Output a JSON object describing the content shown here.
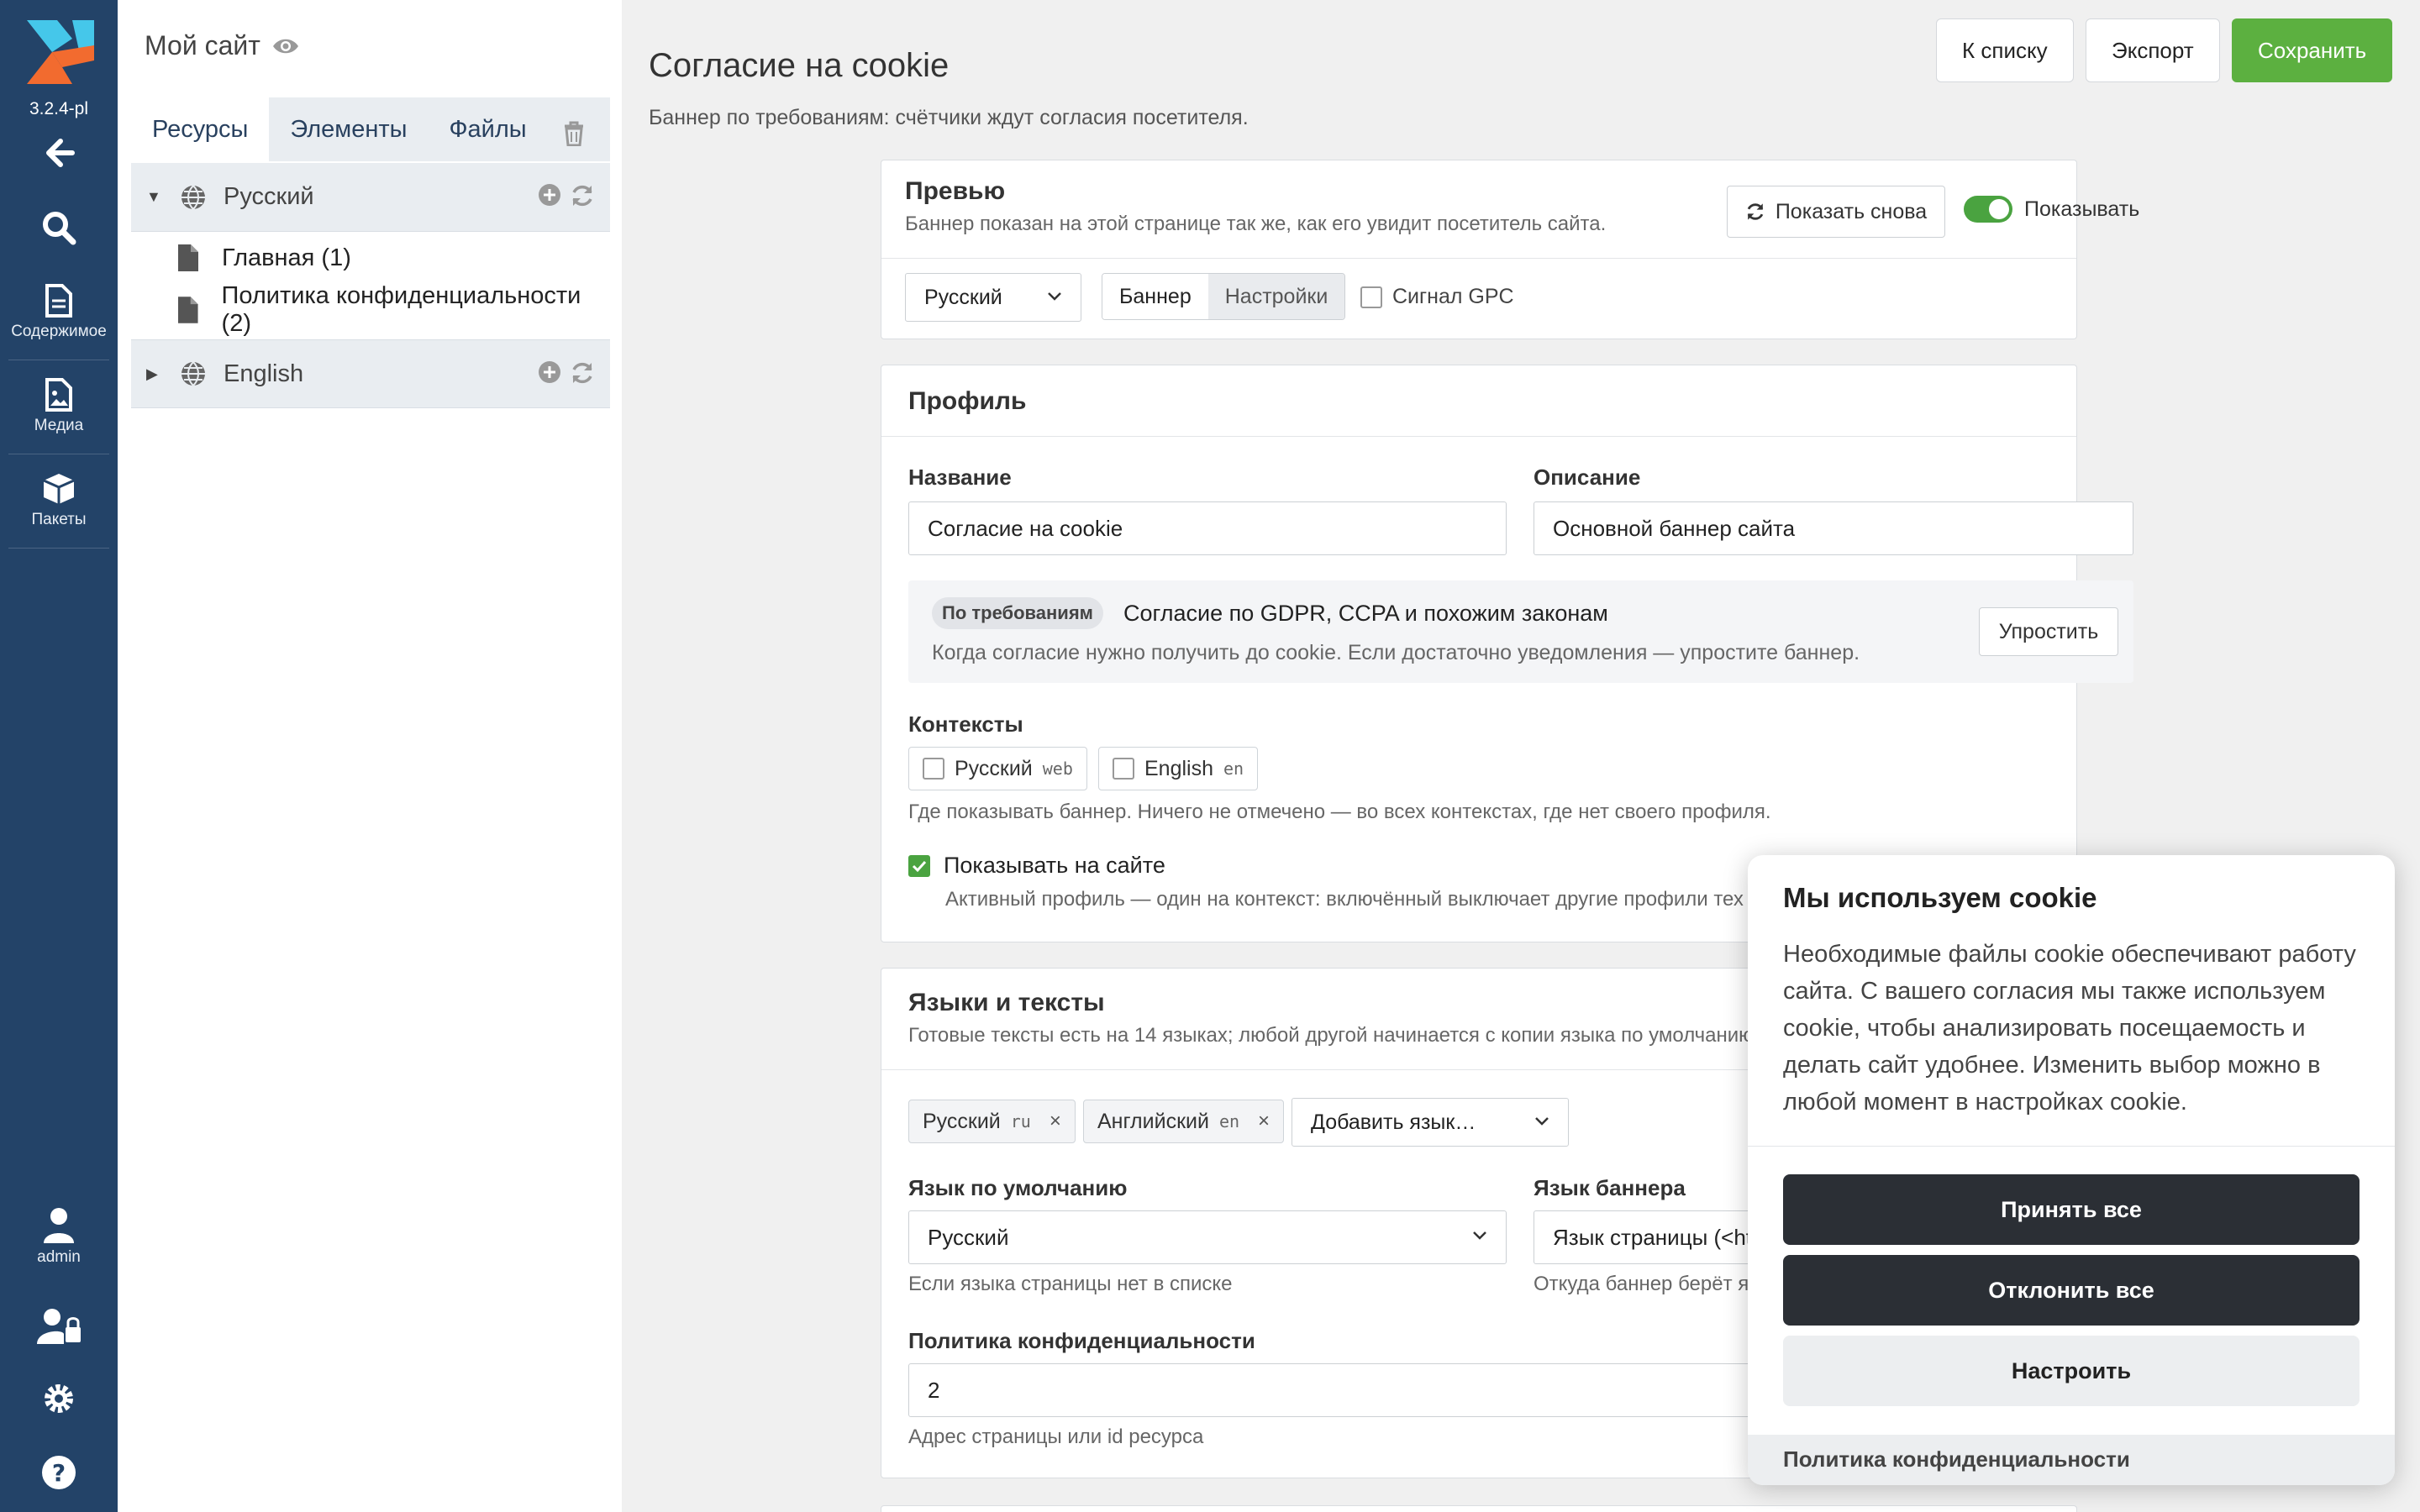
{
  "app": {
    "version": "3.2.4-pl"
  },
  "nav": {
    "content": "Содержимое",
    "media": "Медиа",
    "packages": "Пакеты",
    "user": "admin"
  },
  "tree": {
    "site_title": "Мой сайт",
    "tabs": [
      "Ресурсы",
      "Элементы",
      "Файлы"
    ],
    "contexts": [
      {
        "name": "Русский",
        "resources": [
          "Главная (1)",
          "Политика конфиденциальности (2)"
        ]
      },
      {
        "name": "English",
        "resources": []
      }
    ]
  },
  "page": {
    "title": "Согласие на cookie",
    "subtitle": "Баннер по требованиям: счётчики ждут согласия посетителя.",
    "btn_list": "К списку",
    "btn_export": "Экспорт",
    "btn_save": "Сохранить"
  },
  "preview": {
    "title": "Превью",
    "desc": "Баннер показан на этой странице так же, как его увидит посетитель сайта.",
    "show_again": "Показать снова",
    "toggle_label": "Показывать",
    "language": "Русский",
    "seg": [
      "Баннер",
      "Настройки"
    ],
    "gpc": "Сигнал GPC"
  },
  "profile": {
    "title": "Профиль",
    "name_label": "Название",
    "name_value": "Согласие на cookie",
    "desc_label": "Описание",
    "desc_value": "Основной баннер сайта",
    "badge": "По требованиям",
    "mode_title": "Согласие по GDPR, CCPA и похожим законам",
    "mode_desc": "Когда согласие нужно получить до cookie. Если достаточно уведомления — упростите баннер.",
    "simplify": "Упростить",
    "contexts_label": "Контексты",
    "contexts": [
      {
        "name": "Русский",
        "key": "web"
      },
      {
        "name": "English",
        "key": "en"
      }
    ],
    "contexts_help": "Где показывать баннер. Ничего не отмечено — во всех контекстах, где нет своего профиля.",
    "show_label": "Показывать на сайте",
    "show_help": "Активный профиль — один на контекст: включённый выключает другие профили тех"
  },
  "languages": {
    "title": "Языки и тексты",
    "desc": "Готовые тексты есть на 14 языках; любой другой начинается с копии языка по умолчанию",
    "chips": [
      {
        "name": "Русский",
        "code": "ru"
      },
      {
        "name": "Английский",
        "code": "en"
      }
    ],
    "add_placeholder": "Добавить язык…",
    "default_label": "Язык по умолчанию",
    "default_value": "Русский",
    "default_help": "Если языка страницы нет в списке",
    "banner_lang_label": "Язык баннера",
    "banner_lang_value": "Язык страницы (<ht",
    "banner_lang_help": "Откуда баннер берёт я",
    "policy_label": "Политика конфиденциальности",
    "policy_value": "2",
    "policy_help": "Адрес страницы или id ресурса"
  },
  "cookie_banner": {
    "title": "Мы используем cookie",
    "text": "Необходимые файлы cookie обеспечивают работу сайта. С вашего согласия мы также используем cookie, чтобы анализировать посещаемость и делать сайт удобнее. Изменить выбор можно в любой момент в настройках cookie.",
    "accept": "Принять все",
    "reject": "Отклонить все",
    "customize": "Настроить",
    "policy_link": "Политика конфиденциальности"
  },
  "colors": {
    "sidebar": "#234368",
    "save": "#5cb040",
    "banner_btn": "#2b2f35",
    "toggle_on": "#4aa340"
  }
}
